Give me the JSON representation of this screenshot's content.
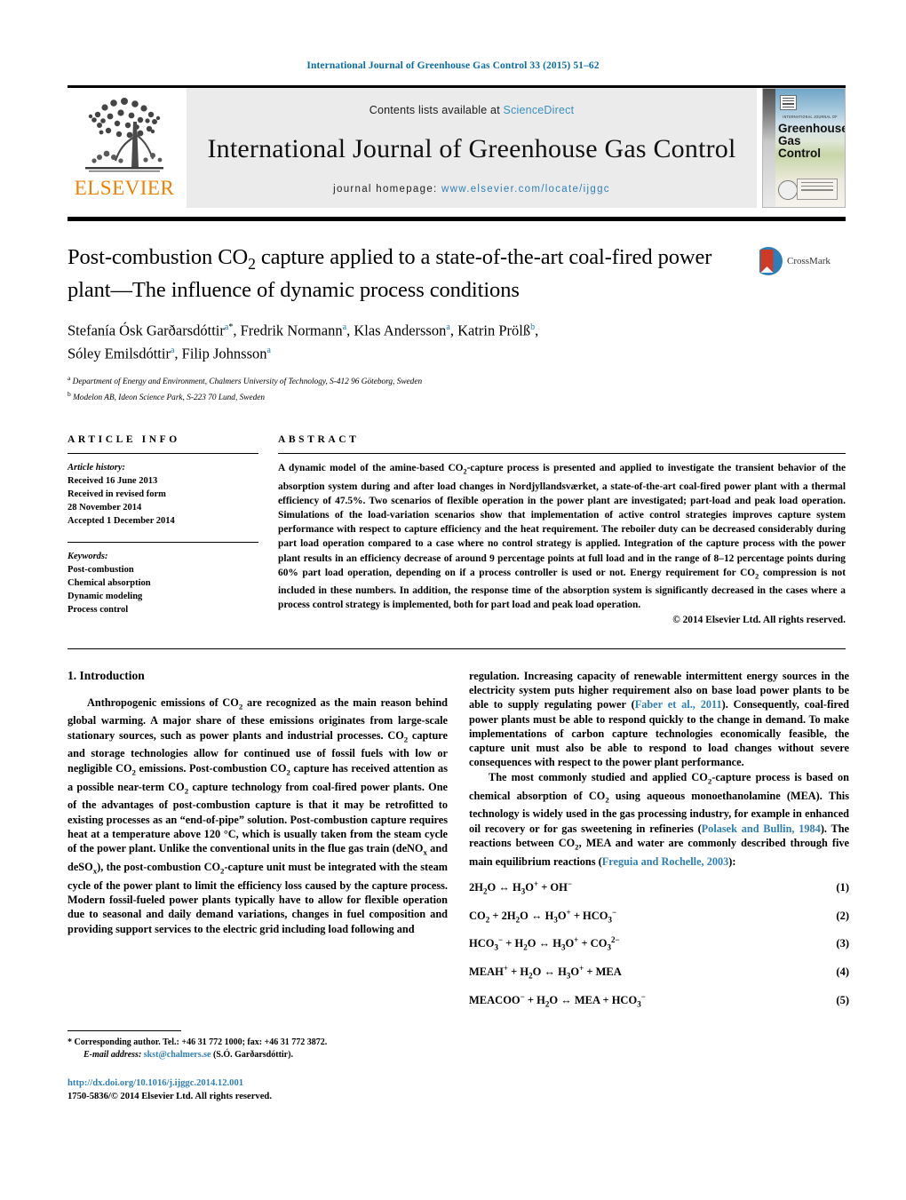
{
  "running_head": "International Journal of Greenhouse Gas Control 33 (2015) 51–62",
  "masthead": {
    "publisher": "ELSEVIER",
    "contents_prefix": "Contents lists available at ",
    "contents_link": "ScienceDirect",
    "journal_title": "International Journal of Greenhouse Gas Control",
    "homepage_prefix": "journal homepage: ",
    "homepage_url": "www.elsevier.com/locate/ijggc",
    "cover": {
      "kicker": "INTERNATIONAL JOURNAL OF",
      "line1": "Greenhouse",
      "line2": "Gas Control"
    }
  },
  "article": {
    "title_line1_a": "Post-combustion CO",
    "title_line1_sub": "2",
    "title_line1_b": " capture applied to a state-of-the-art coal-fired",
    "title_line2": "power plant—The influence of dynamic process conditions",
    "crossmark_label": "CrossMark",
    "authors_line1": "Stefanía Ósk Garðarsdóttir",
    "authors_line1_rest": ", Fredrik Normann",
    "authors_line1_rest2": ", Klas Andersson",
    "authors_line1_rest3": ", Katrin Prölß",
    "authors_line2": "Sóley Emilsdóttir",
    "authors_line2_rest": ", Filip Johnsson",
    "affiliation_a": "Department of Energy and Environment, Chalmers University of Technology, S-412 96 Göteborg, Sweden",
    "affiliation_b": "Modelon AB, Ideon Science Park, S-223 70 Lund, Sweden",
    "marker_a": "a",
    "marker_b": "b",
    "marker_star": "*"
  },
  "article_info": {
    "heading": "ARTICLE INFO",
    "history_label": "Article history:",
    "history": [
      "Received 16 June 2013",
      "Received in revised form",
      "28 November 2014",
      "Accepted 1 December 2014"
    ],
    "keywords_label": "Keywords:",
    "keywords": [
      "Post-combustion",
      "Chemical absorption",
      "Dynamic modeling",
      "Process control"
    ]
  },
  "abstract": {
    "heading": "ABSTRACT",
    "text": "A dynamic model of the amine-based CO2-capture process is presented and applied to investigate the transient behavior of the absorption system during and after load changes in Nordjyllandsværket, a state-of-the-art coal-fired power plant with a thermal efficiency of 47.5%. Two scenarios of flexible operation in the power plant are investigated; part-load and peak load operation. Simulations of the load-variation scenarios show that implementation of active control strategies improves capture system performance with respect to capture efficiency and the heat requirement. The reboiler duty can be decreased considerably during part load operation compared to a case where no control strategy is applied. Integration of the capture process with the power plant results in an efficiency decrease of around 9 percentage points at full load and in the range of 8–12 percentage points during 60% part load operation, depending on if a process controller is used or not. Energy requirement for CO2 compression is not included in these numbers. In addition, the response time of the absorption system is significantly decreased in the cases where a process control strategy is implemented, both for part load and peak load operation.",
    "copyright": "© 2014 Elsevier Ltd. All rights reserved."
  },
  "body": {
    "section_number_title": "1.  Introduction",
    "left_paragraph_1": "Anthropogenic emissions of CO2 are recognized as the main reason behind global warming. A major share of these emissions originates from large-scale stationary sources, such as power plants and industrial processes. CO2 capture and storage technologies allow for continued use of fossil fuels with low or negligible CO2 emissions. Post-combustion CO2 capture has received attention as a possible near-term CO2 capture technology from coal-fired power plants. One of the advantages of post-combustion capture is that it may be retrofitted to existing processes as an “end-of-pipe” solution. Post-combustion capture requires heat at a temperature above 120 °C, which is usually taken from the steam cycle of the power plant. Unlike the conventional units in the flue gas train (deNOx and deSOx), the post-combustion CO2-capture unit must be integrated with the steam cycle of the power plant to limit the efficiency loss caused by the capture process. Modern fossil-fueled power plants typically have to allow for flexible operation due to seasonal and daily demand variations, changes in fuel composition and providing support services to the electric grid including load following and",
    "right_paragraph_1_a": "regulation. Increasing capacity of renewable intermittent energy sources in the electricity system puts higher requirement also on base load power plants to be able to supply regulating power (",
    "right_paragraph_1_ref": "Faber et al., 2011",
    "right_paragraph_1_b": "). Consequently, coal-fired power plants must be able to respond quickly to the change in demand. To make implementations of carbon capture technologies economically feasible, the capture unit must also be able to respond to load changes without severe consequences with respect to the power plant performance.",
    "right_paragraph_2_a": "The most commonly studied and applied CO2-capture process is based on chemical absorption of CO2 using aqueous monoethanolamine (MEA). This technology is widely used in the gas processing industry, for example in enhanced oil recovery or for gas sweetening in refineries (",
    "right_paragraph_2_ref1": "Polasek and Bullin, 1984",
    "right_paragraph_2_b": "). The reactions between CO2, MEA and water are commonly described through five main equilibrium reactions (",
    "right_paragraph_2_ref2": "Freguia and Rochelle, 2003",
    "right_paragraph_2_c": "):"
  },
  "equations": [
    {
      "num": "(1)"
    },
    {
      "num": "(2)"
    },
    {
      "num": "(3)"
    },
    {
      "num": "(4)"
    },
    {
      "num": "(5)"
    }
  ],
  "footnote": {
    "star": "*",
    "corresponding": " Corresponding author. Tel.: +46 31 772 1000; fax: +46 31 772 3872.",
    "email_label": "E-mail address:",
    "email": "skst@chalmers.se",
    "email_suffix": " (S.Ó. Garðarsdóttir).",
    "doi": "http://dx.doi.org/10.1016/j.ijggc.2014.12.001",
    "issn_line": "1750-5836/© 2014 Elsevier Ltd. All rights reserved."
  },
  "colors": {
    "link_blue": "#2f7fb5",
    "running_head_blue": "#0b6ca3",
    "elsevier_orange": "#f08000",
    "band_gray": "#ebebeb"
  }
}
